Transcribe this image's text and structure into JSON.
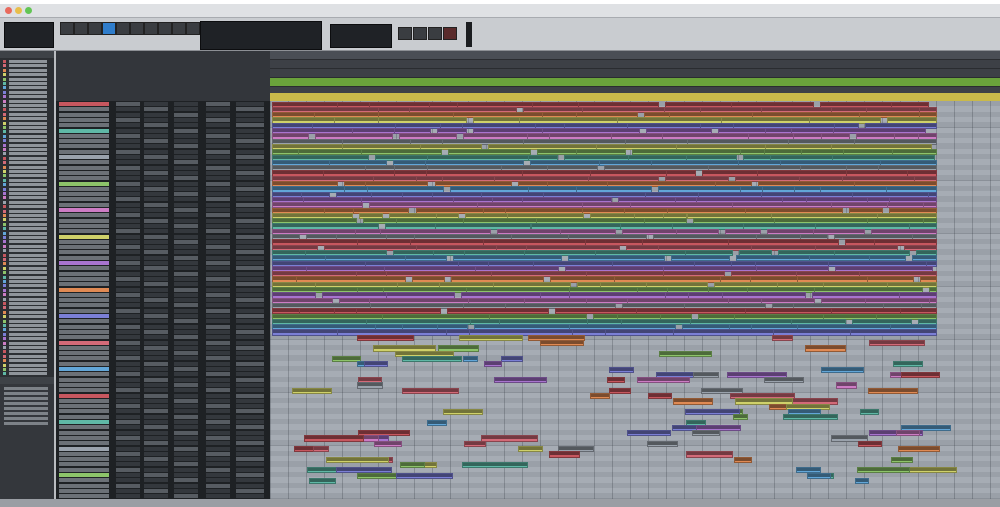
{
  "colors": {
    "window_bg": "#b9bcc0",
    "dark_panel": "#2c2f33",
    "track_area": "#9fa5ad",
    "clip_palette": [
      "#c7575f",
      "#d36a78",
      "#e08a54",
      "#cfd16a",
      "#8dc46a",
      "#5fb8a6",
      "#62a6d8",
      "#7b7fd6",
      "#a874cf",
      "#cd7cc4",
      "#9aa2ac"
    ]
  }
}
